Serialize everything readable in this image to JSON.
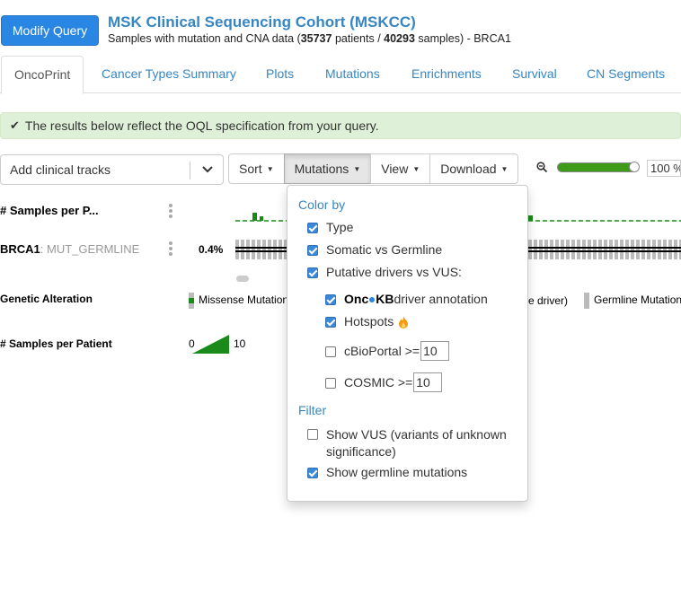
{
  "header": {
    "modify_button": "Modify Query",
    "title": "MSK Clinical Sequencing Cohort (MSKCC)",
    "subtitle_prefix": "Samples with mutation and CNA data (",
    "patients": "35737",
    "patients_word": " patients / ",
    "samples": "40293",
    "samples_word": " samples)",
    "gene_suffix": "  - BRCA1"
  },
  "tabs": [
    "OncoPrint",
    "Cancer Types Summary",
    "Plots",
    "Mutations",
    "Enrichments",
    "Survival",
    "CN Segments"
  ],
  "alert": {
    "text": "The results below reflect the OQL specification from your query."
  },
  "toolbar": {
    "clinical_tracks": "Add clinical tracks",
    "sort": "Sort",
    "mutations": "Mutations",
    "view": "View",
    "download": "Download",
    "zoom_value": "100 %",
    "zoom_level": 0.9
  },
  "tracks": {
    "samples_per_patient_short": "# Samples per P...",
    "gene": "BRCA1",
    "gene_suffix": ": MUT_GERMLINE",
    "percent": "0.4%"
  },
  "legend": {
    "genetic_alteration": "Genetic Alteration",
    "missense": "Missense Mutation",
    "driver_suffix": "e driver)",
    "germline": "Germline Mutation",
    "samples_per_patient": "# Samples per Patient",
    "scale_min": "0",
    "scale_max": "10"
  },
  "dropdown": {
    "color_by": "Color by",
    "type": "Type",
    "somatic": "Somatic vs Germline",
    "putative": "Putative drivers vs VUS:",
    "oncokb_a": "Onc",
    "oncokb_b": "KB",
    "oncokb_rest": " driver annotation",
    "hotspots": "Hotspots",
    "cbioportal": "cBioPortal >=",
    "cbioportal_value": "10",
    "cosmic": "COSMIC >=",
    "cosmic_value": "10",
    "filter": "Filter",
    "show_vus_1": "Show VUS (variants of unknown",
    "show_vus_2": "significance)",
    "show_germline": "Show germline mutations"
  },
  "colors": {
    "accent": "#3786c2",
    "button": "#2986e2",
    "alert_bg": "#dff0d8",
    "green": "#1a8a1a"
  }
}
